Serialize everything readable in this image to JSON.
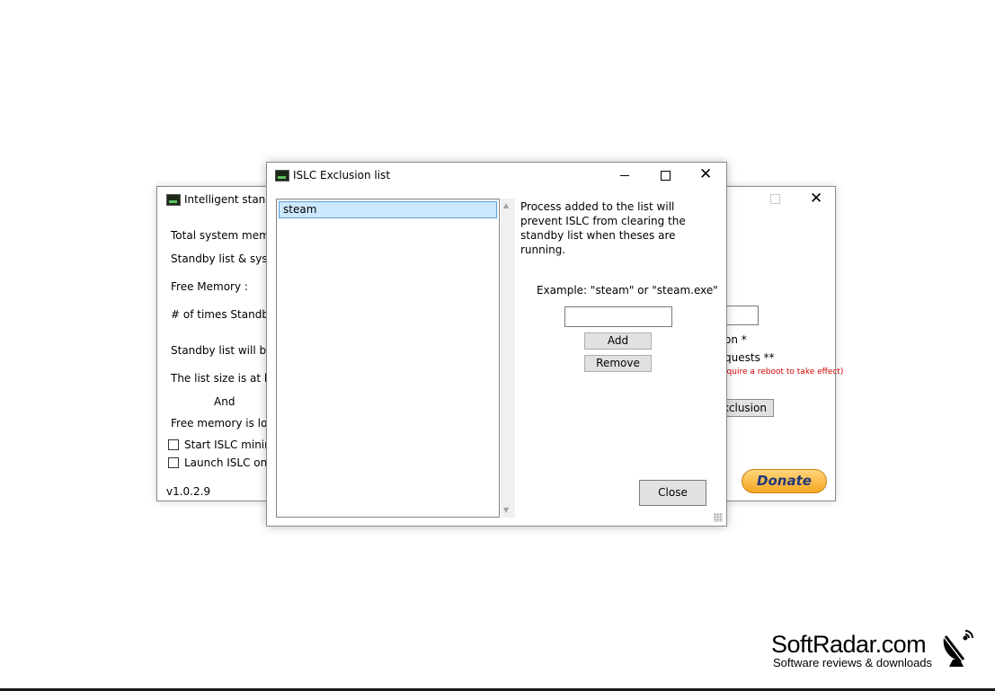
{
  "back_window": {
    "title": "Intelligent standb",
    "labels": {
      "total_memory": "Total system memor",
      "standby_system": "Standby list & syster",
      "free_memory": "Free Memory :",
      "times_standby": "# of times Standby l",
      "standby_will_be": "Standby list will be p",
      "list_size": "The list size is at leas",
      "and": "And",
      "free_lower": "Free memory is lowe"
    },
    "checkboxes": {
      "start_minimized": "Start ISLC minimiz",
      "launch_on": "Launch ISLC on u"
    },
    "right_labels": {
      "option_a": "on *",
      "option_b": "quests **",
      "reboot_note": "equire a reboot to take effect)"
    },
    "exclusion_button": "xclusion",
    "donate_button": "Donate",
    "version": "v1.0.2.9"
  },
  "front_window": {
    "title": "ISLC Exclusion list",
    "list_items": [
      "steam"
    ],
    "description": "Process added to the list will prevent ISLC from clearing the standby list when theses are running.",
    "example": "Example: \"steam\" or \"steam.exe\"",
    "process_input": {
      "value": "",
      "placeholder": ""
    },
    "add_button": "Add",
    "remove_button": "Remove",
    "close_button": "Close"
  },
  "watermark": {
    "name": "SoftRadar.com",
    "tagline": "Software reviews & downloads"
  },
  "icons": {
    "app": "islc-app-icon",
    "close": "close-icon",
    "maximize": "maximize-icon",
    "minimize": "minimize-icon",
    "satellite": "satellite-dish-icon"
  }
}
